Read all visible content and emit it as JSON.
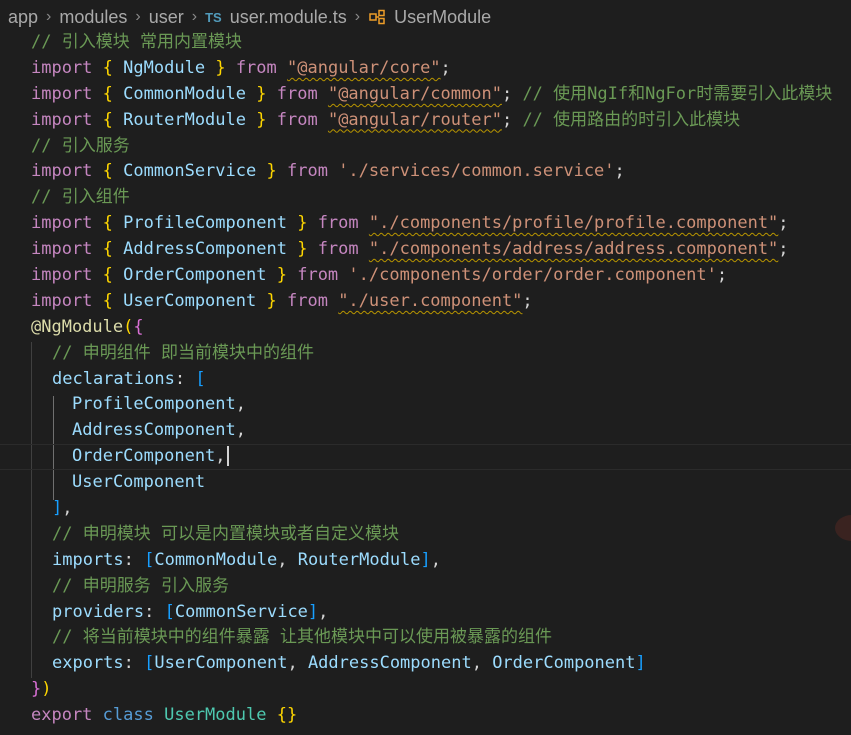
{
  "breadcrumb": {
    "items": [
      "app",
      "modules",
      "user"
    ],
    "file_icon": "TS",
    "file_name": "user.module.ts",
    "symbol_icon": "class-symbol-icon",
    "symbol": "UserModule"
  },
  "code": {
    "c1": "// 引入模块 常用内置模块",
    "kw_import": "import",
    "kw_from": "from",
    "kw_export": "export",
    "kw_class": "class",
    "lb": "{",
    "rb": "}",
    "ngmodule": "NgModule",
    "angular_core": "\"@angular/core\"",
    "commonmodule": "CommonModule",
    "angular_common": "\"@angular/common\"",
    "c2": "// 使用NgIf和NgFor时需要引入此模块",
    "routermodule": "RouterModule",
    "angular_router": "\"@angular/router\"",
    "c3": "// 使用路由的时引入此模块",
    "c4": "// 引入服务",
    "commonservice": "CommonService",
    "service_path": "'./services/common.service'",
    "c5": "// 引入组件",
    "profilecomponent": "ProfileComponent",
    "profile_path": "\"./components/profile/profile.component\"",
    "addresscomponent": "AddressComponent",
    "address_path": "\"./components/address/address.component\"",
    "ordercomponent": "OrderComponent",
    "order_path": "'./components/order/order.component'",
    "usercomponent": "UserComponent",
    "user_path": "\"./user.component\"",
    "decorator": "@NgModule",
    "c6": "// 申明组件 即当前模块中的组件",
    "declarations": "declarations",
    "c7": "// 申明模块 可以是内置模块或者自定义模块",
    "imports": "imports",
    "c8": "// 申明服务 引入服务",
    "providers": "providers",
    "c9": "// 将当前模块中的组件暴露 让其他模块中可以使用被暴露的组件",
    "exports": "exports",
    "usermodule": "UserModule"
  }
}
